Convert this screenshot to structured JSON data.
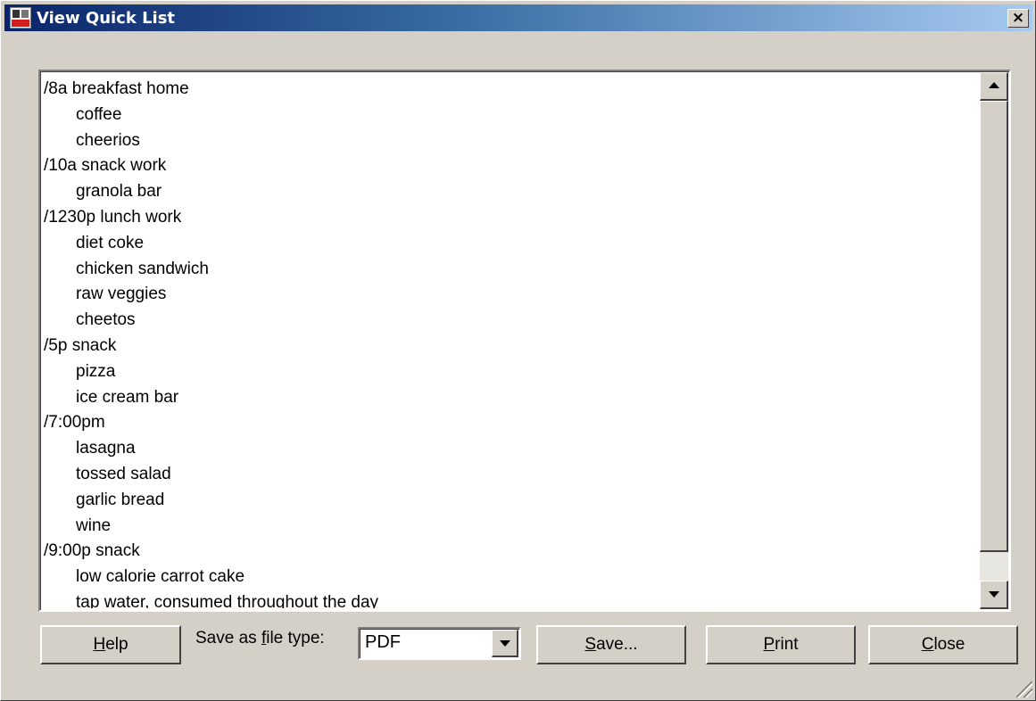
{
  "window": {
    "title": "View Quick List",
    "close_glyph": "×",
    "app_icon": "nutrition-app-icon"
  },
  "list": {
    "lines": [
      {
        "text": "/8a breakfast home",
        "indent": false
      },
      {
        "text": "coffee",
        "indent": true
      },
      {
        "text": "cheerios",
        "indent": true
      },
      {
        "text": "/10a snack work",
        "indent": false
      },
      {
        "text": "granola bar",
        "indent": true
      },
      {
        "text": "/1230p lunch work",
        "indent": false
      },
      {
        "text": "diet coke",
        "indent": true
      },
      {
        "text": "chicken sandwich",
        "indent": true
      },
      {
        "text": "raw veggies",
        "indent": true
      },
      {
        "text": "cheetos",
        "indent": true
      },
      {
        "text": "/5p snack",
        "indent": false
      },
      {
        "text": "pizza",
        "indent": true
      },
      {
        "text": "ice cream bar",
        "indent": true
      },
      {
        "text": "/7:00pm",
        "indent": false
      },
      {
        "text": "lasagna",
        "indent": true
      },
      {
        "text": "tossed salad",
        "indent": true
      },
      {
        "text": "garlic bread",
        "indent": true
      },
      {
        "text": "wine",
        "indent": true
      },
      {
        "text": "/9:00p snack",
        "indent": false
      },
      {
        "text": "low calorie carrot cake",
        "indent": true
      },
      {
        "text": "tap water, consumed throughout the day",
        "indent": true
      }
    ]
  },
  "footer": {
    "help": {
      "mnemonic": "H",
      "rest": "elp"
    },
    "filetype_label": {
      "before": "Save as ",
      "mnemonic": "f",
      "after": "ile type:"
    },
    "filetype_value": "PDF",
    "save": {
      "mnemonic": "S",
      "rest": "ave..."
    },
    "print": {
      "mnemonic": "P",
      "rest": "rint"
    },
    "close": {
      "mnemonic": "C",
      "rest": "lose"
    }
  },
  "colors": {
    "title_gradient_start": "#0a246a",
    "title_gradient_end": "#a6caf0",
    "face": "#d4d0c8"
  }
}
